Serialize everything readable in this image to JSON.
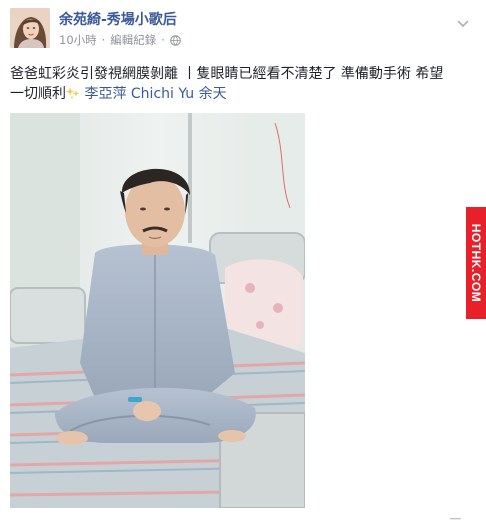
{
  "post": {
    "author": "余苑綺-秀場小歌后",
    "time": "10小時",
    "separator": "·",
    "edit_history": "編輯紀錄",
    "separator2": "·",
    "audience_icon": "globe-icon",
    "menu_icon": "chevron-down-icon",
    "text_line1": "爸爸虹彩炎引發視網膜剝離 丨隻眼睛已經看不清楚了 準備動手術 希望",
    "text_line2_prefix": "一切順利",
    "text_emoji_icon": "sparkle-icon",
    "tags": "李亞萍 Chichi Yu 余天",
    "photo_subject": "man sitting on a hospital bed"
  },
  "watermark": {
    "label": "HOTHK.COM",
    "color": "#e8202a"
  },
  "corner_mark": "▁▁"
}
